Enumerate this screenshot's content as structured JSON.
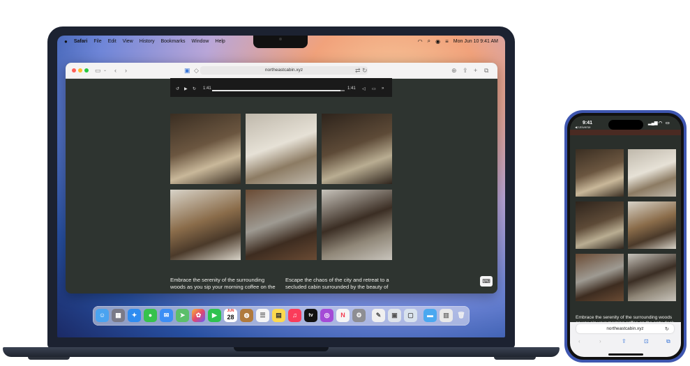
{
  "mac": {
    "menubar": {
      "apple": "",
      "app_name": "Safari",
      "menus": [
        "File",
        "Edit",
        "View",
        "History",
        "Bookmarks",
        "Window",
        "Help"
      ],
      "datetime": "Mon Jun 10  9:41 AM"
    },
    "safari": {
      "url": "northeastcabin.xyz",
      "video": {
        "current_time": "1:41",
        "remaining_time": "1:41",
        "progress": 0.97
      },
      "photos": [
        {
          "name": "cabin-dining-nook",
          "colors": [
            "#3a2e22",
            "#6b5640",
            "#c9b89a"
          ]
        },
        {
          "name": "cabin-bedroom",
          "colors": [
            "#bfb8ab",
            "#e6e1d6",
            "#8c7b63"
          ]
        },
        {
          "name": "cabin-wood-stove",
          "colors": [
            "#2e241c",
            "#5d4a37",
            "#b9ad92"
          ]
        },
        {
          "name": "cabin-desk",
          "colors": [
            "#d8d3c8",
            "#8a6c4a",
            "#4b3a2a"
          ]
        },
        {
          "name": "cabin-living-room",
          "colors": [
            "#6a4b34",
            "#9e9a92",
            "#3d2c20"
          ]
        },
        {
          "name": "cabin-kitchen",
          "colors": [
            "#c8c4bc",
            "#3b2e24",
            "#8f8677"
          ]
        }
      ],
      "text_left": "Embrace the serenity of the surrounding woods as you sip your morning coffee on the cozy deck overlooking the towering",
      "text_right": "Escape the chaos of the city and retreat to a secluded cabin surrounded by the beauty of nature. This charming cabin"
    },
    "dock": {
      "calendar_month": "JUN",
      "calendar_day": "28",
      "tv_label": "tv"
    }
  },
  "iphone": {
    "time": "9:41",
    "carrier_back": "◀ Universe",
    "text": "Embrace the serenity of the surrounding woods as you sip your morning coffee on the cozy deck",
    "url": "northeastcabin.xyz"
  }
}
